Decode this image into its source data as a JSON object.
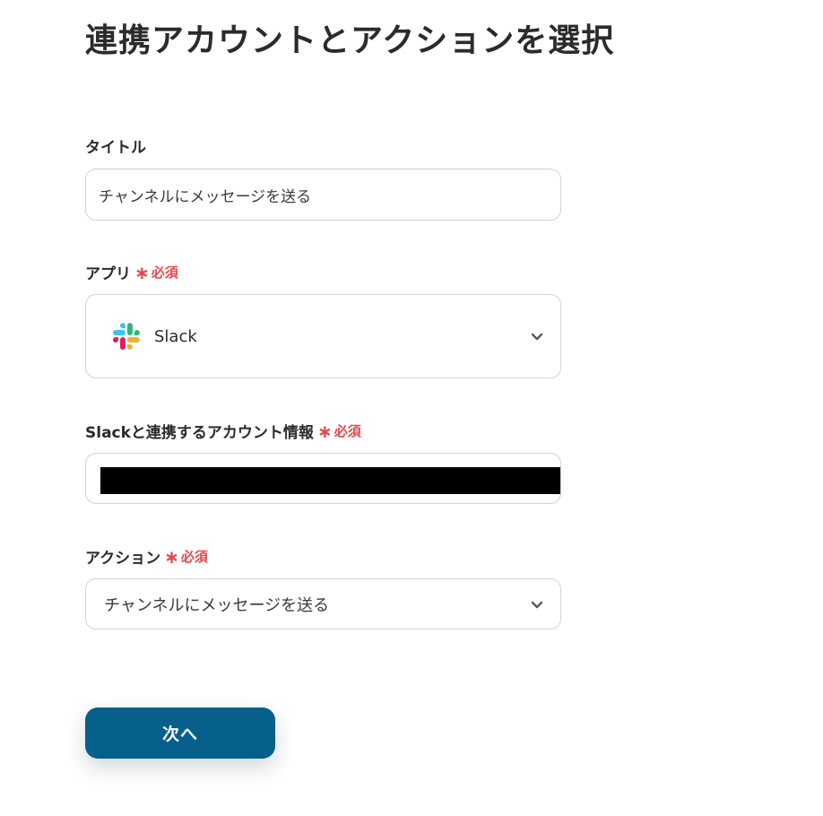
{
  "page": {
    "title": "連携アカウントとアクションを選択"
  },
  "form": {
    "title_field": {
      "label": "タイトル",
      "value": "チャンネルにメッセージを送る"
    },
    "app_field": {
      "label": "アプリ",
      "required_mark": "∗",
      "required_text": "必須",
      "selected_app": "Slack",
      "app_icon": "slack-logo-icon",
      "dropdown_icon": "chevron-down-icon"
    },
    "account_field": {
      "label": "Slackと連携するアカウント情報",
      "required_mark": "∗",
      "required_text": "必須",
      "value_redacted": true
    },
    "action_field": {
      "label": "アクション",
      "required_mark": "∗",
      "required_text": "必須",
      "selected_action": "チャンネルにメッセージを送る",
      "dropdown_icon": "chevron-down-icon"
    },
    "next_button": {
      "label": "次へ"
    }
  },
  "colors": {
    "primary_button": "#06608b",
    "required": "#e5484d",
    "border": "#cfd3d8",
    "text": "#2b2b2b",
    "slack_blue": "#36c5f0",
    "slack_green": "#2eb67d",
    "slack_yellow": "#ecb22e",
    "slack_red": "#e01e5a"
  }
}
